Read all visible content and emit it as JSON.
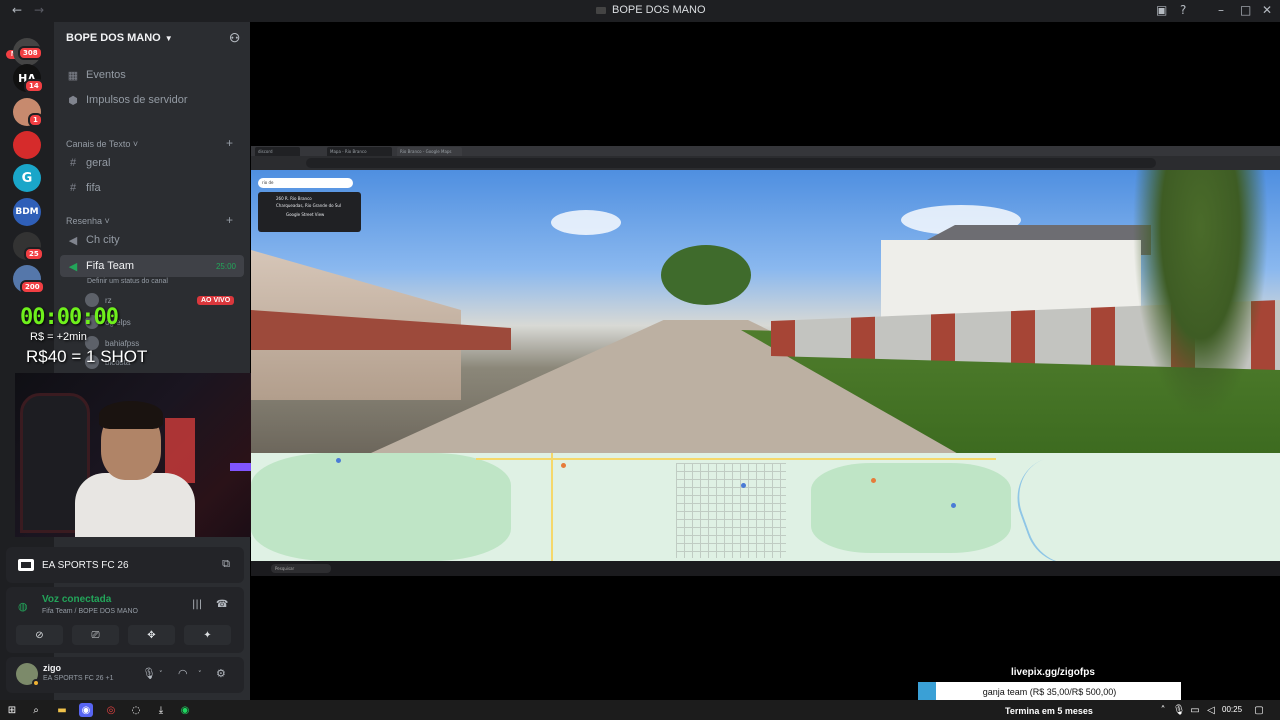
{
  "window": {
    "title": "BOPE DOS MANO",
    "back": "←",
    "forward": "→"
  },
  "rail": {
    "novo_label": "NOVO",
    "badges": [
      "308",
      "14",
      "1",
      "25",
      "200"
    ],
    "servers": [
      "HA",
      "BDM"
    ]
  },
  "sidebar": {
    "server_name": "BOPE DOS MANO",
    "items": [
      {
        "label": "Eventos",
        "icon": "calendar-icon"
      },
      {
        "label": "Impulsos de servidor",
        "icon": "boost-icon"
      }
    ],
    "categories": [
      {
        "label": "Canais de Texto",
        "channels": [
          "geral",
          "fifa"
        ]
      },
      {
        "label": "Resenha",
        "channels": [
          "Ch city",
          "Fifa Team"
        ]
      }
    ],
    "active_channel_time": "25:00",
    "active_channel_status": "Definir um status do canal",
    "voice_users": [
      "rz",
      "ogfelps",
      "bahiafpss",
      "bicosta"
    ],
    "live_badge": "AO VIVO"
  },
  "overlay": {
    "timer": "00:00:00",
    "line1": "R$ = +2min",
    "line2": "R$40 = 1 SHOT"
  },
  "activity": {
    "game": "EA SPORTS FC 26"
  },
  "voice": {
    "status": "Voz conectada",
    "location": "Fifa Team / BOPE DOS MANO"
  },
  "user": {
    "name": "zigo",
    "activity": "EA SPORTS FC 26 +1"
  },
  "stream": {
    "tabs": [
      "discord",
      "Mapa - Rio Branco",
      "Rio Branco - Google Maps"
    ],
    "map_search": "rio de",
    "sv_card_title": "260 R. Rio Branco",
    "sv_card_sub": "Charqueadas, Rio Grande do Sul",
    "sv_card_brand": "Google Street View",
    "taskbar_search": "Pesquisar"
  },
  "livepix": {
    "url": "livepix.gg/zigofps",
    "goal_text": "ganja team (R$ 35,00/R$ 500,00)",
    "progress": 0.07,
    "ends": "Termina em 5 meses"
  },
  "taskbar": {
    "clock": "00:25"
  },
  "colors": {
    "accent_green": "#23a55a",
    "danger": "#f23f43",
    "timer_green": "#6ff01c",
    "livepix_fill": "#3aa0d6"
  }
}
